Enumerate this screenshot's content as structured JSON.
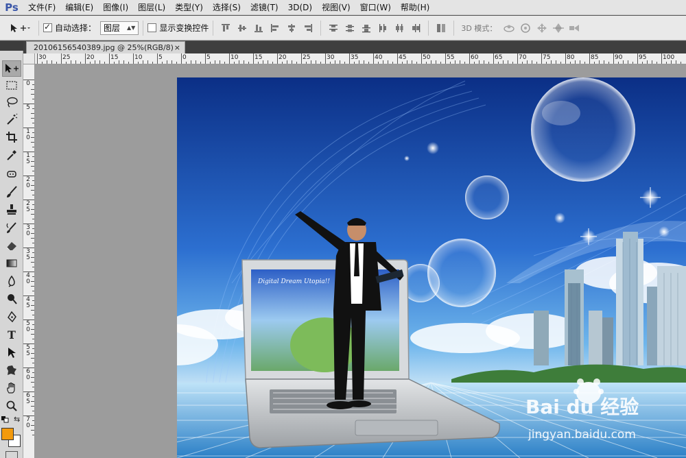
{
  "app": {
    "logo": "Ps"
  },
  "menu": [
    "文件(F)",
    "编辑(E)",
    "图像(I)",
    "图层(L)",
    "类型(Y)",
    "选择(S)",
    "滤镜(T)",
    "3D(D)",
    "视图(V)",
    "窗口(W)",
    "帮助(H)"
  ],
  "options": {
    "auto_select_label": "自动选择：",
    "auto_select_checked": true,
    "layer_select_value": "图层",
    "show_transform_label": "显示变换控件",
    "mode_3d_label": "3D 模式："
  },
  "document": {
    "tab_title": "20106156540389.jpg @ 25%(RGB/8)",
    "close": "×"
  },
  "ruler": {
    "h_labels": [
      "30",
      "25",
      "20",
      "15",
      "10",
      "5",
      "0",
      "5",
      "10",
      "15",
      "20",
      "25",
      "30",
      "35",
      "40",
      "45",
      "50",
      "55",
      "60",
      "65",
      "70",
      "75",
      "80",
      "85",
      "90",
      "95",
      "100"
    ],
    "v_labels": [
      "0",
      "5",
      "1\n0",
      "1\n5",
      "2\n0",
      "2\n5",
      "3\n0",
      "3\n5",
      "4\n0",
      "4\n5",
      "5\n0",
      "5\n5",
      "6\n0",
      "6\n5",
      "7\n0"
    ]
  },
  "image_content": {
    "screen_text": "Digital Dream Utopia!!",
    "watermark_brand": "Bai du 经验",
    "watermark_url": "jingyan.baidu.com"
  },
  "colors": {
    "foreground": "#f39a0d",
    "background": "#ffffff",
    "sky_top": "#0b2f86",
    "sky_mid": "#2c6fd0",
    "grid_floor": "#4aa3dd"
  },
  "tools": [
    "move-tool",
    "marquee-tool",
    "lasso-tool",
    "quick-select-tool",
    "crop-tool",
    "eyedropper-tool",
    "healing-brush-tool",
    "brush-tool",
    "clone-stamp-tool",
    "history-brush-tool",
    "eraser-tool",
    "gradient-tool",
    "blur-tool",
    "dodge-tool",
    "pen-tool",
    "type-tool",
    "path-select-tool",
    "shape-tool",
    "hand-tool",
    "zoom-tool"
  ],
  "type_tool_glyph": "T"
}
